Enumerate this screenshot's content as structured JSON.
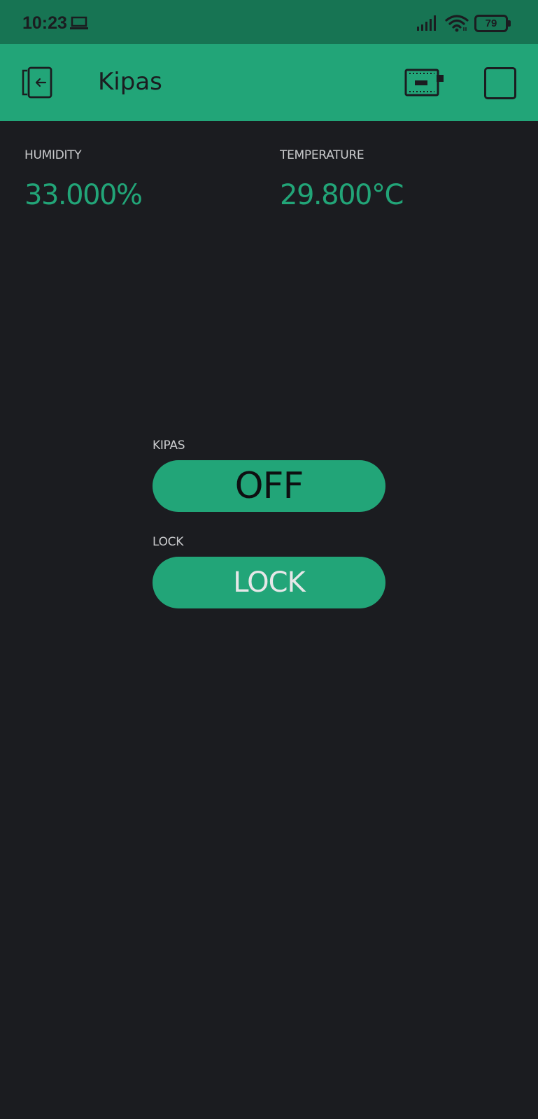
{
  "status_bar": {
    "time": "10:23",
    "battery": "79",
    "icons": [
      "laptop-icon",
      "signal-icon",
      "wifi-icon",
      "battery-icon"
    ]
  },
  "header": {
    "title": "Kipas",
    "icons": [
      "exit-icon",
      "device-icon",
      "square-icon"
    ]
  },
  "humidity": {
    "label": "HUMIDITY",
    "value": "33.000%"
  },
  "temperature": {
    "label": "TEMPERATURE",
    "value": "29.800°C"
  },
  "kipas_button": {
    "label": "KIPAS",
    "state": "OFF"
  },
  "lock_button": {
    "label": "LOCK",
    "state": "LOCK"
  },
  "colors": {
    "status_bar_bg": "#177453",
    "header_bg": "#22a578",
    "background": "#1b1c20",
    "accent": "#22a578",
    "label_text": "#c9cacc"
  }
}
